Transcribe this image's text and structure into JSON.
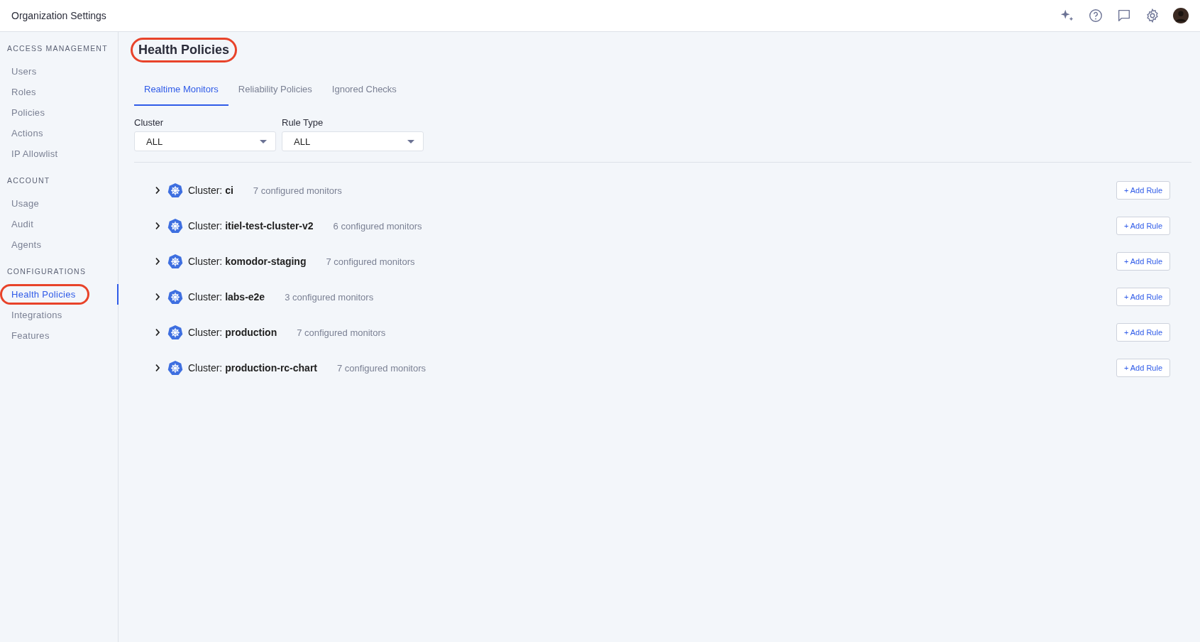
{
  "header": {
    "title": "Organization Settings"
  },
  "sidebar": {
    "sections": [
      {
        "heading": "ACCESS MANAGEMENT",
        "items": [
          {
            "label": "Users",
            "selected": false,
            "highlighted": false
          },
          {
            "label": "Roles",
            "selected": false,
            "highlighted": false
          },
          {
            "label": "Policies",
            "selected": false,
            "highlighted": false
          },
          {
            "label": "Actions",
            "selected": false,
            "highlighted": false
          },
          {
            "label": "IP Allowlist",
            "selected": false,
            "highlighted": false
          }
        ]
      },
      {
        "heading": "ACCOUNT",
        "items": [
          {
            "label": "Usage",
            "selected": false,
            "highlighted": false
          },
          {
            "label": "Audit",
            "selected": false,
            "highlighted": false
          },
          {
            "label": "Agents",
            "selected": false,
            "highlighted": false
          }
        ]
      },
      {
        "heading": "CONFIGURATIONS",
        "items": [
          {
            "label": "Health Policies",
            "selected": true,
            "highlighted": true
          },
          {
            "label": "Integrations",
            "selected": false,
            "highlighted": false
          },
          {
            "label": "Features",
            "selected": false,
            "highlighted": false
          }
        ]
      }
    ]
  },
  "page": {
    "title": "Health Policies",
    "highlighted": true
  },
  "tabs": [
    {
      "label": "Realtime Monitors",
      "selected": true
    },
    {
      "label": "Reliability Policies",
      "selected": false
    },
    {
      "label": "Ignored Checks",
      "selected": false
    }
  ],
  "filters": [
    {
      "label": "Cluster",
      "value": "ALL"
    },
    {
      "label": "Rule Type",
      "value": "ALL"
    }
  ],
  "clusters": [
    {
      "name": "Cluster: **ci**",
      "count": "7 configured monitors",
      "expanded": false,
      "button": "+ Add Rule"
    },
    {
      "name": "Cluster: **itiel-test-cluster-v2**",
      "count": "6 configured monitors",
      "expanded": false,
      "button": "+ Add Rule"
    },
    {
      "name": "Cluster: **komodor-staging**",
      "count": "7 configured monitors",
      "expanded": false,
      "button": "+ Add Rule"
    },
    {
      "name": "Cluster: **labs-e2e**",
      "count": "3 configured monitors",
      "expanded": false,
      "button": "+ Add Rule"
    },
    {
      "name": "Cluster: **production**",
      "count": "7 configured monitors",
      "expanded": false,
      "button": "+ Add Rule"
    },
    {
      "name": "Cluster: **production-rc-chart**",
      "count": "7 configured monitors",
      "expanded": false,
      "button": "+ Add Rule"
    }
  ]
}
